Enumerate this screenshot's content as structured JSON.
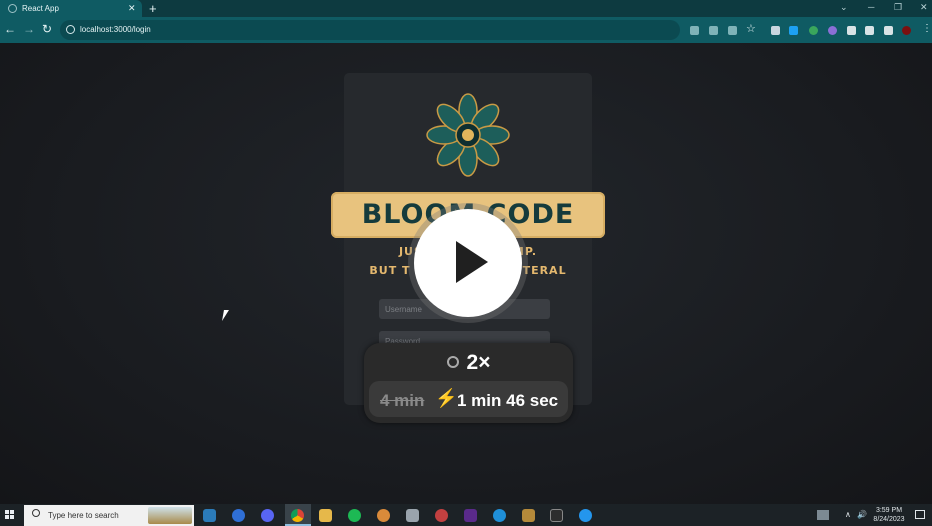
{
  "browser": {
    "tab_title": "React App",
    "url": "localhost:3000/login"
  },
  "login": {
    "banner_title": "BLOOM CODE CAMP",
    "tagline_line1": "JUS",
    "tagline_line1_end": "MP.",
    "tagline_line2": "BUT T",
    "tagline_line2_end": "TERAL",
    "username_placeholder": "Username",
    "password_placeholder": "Password"
  },
  "playback": {
    "speed": "2×",
    "original_duration": "4 min",
    "new_duration": "1 min 46 sec"
  },
  "taskbar": {
    "search_placeholder": "Type here to search",
    "time": "3:59 PM",
    "date": "8/24/2023"
  },
  "colors": {
    "chrome_teal": "#0f5b63",
    "banner_gold": "#e8c37e",
    "banner_text": "#153b3c",
    "tagline_gold": "#e4b86e",
    "speed_bolt": "#f08a2c"
  }
}
